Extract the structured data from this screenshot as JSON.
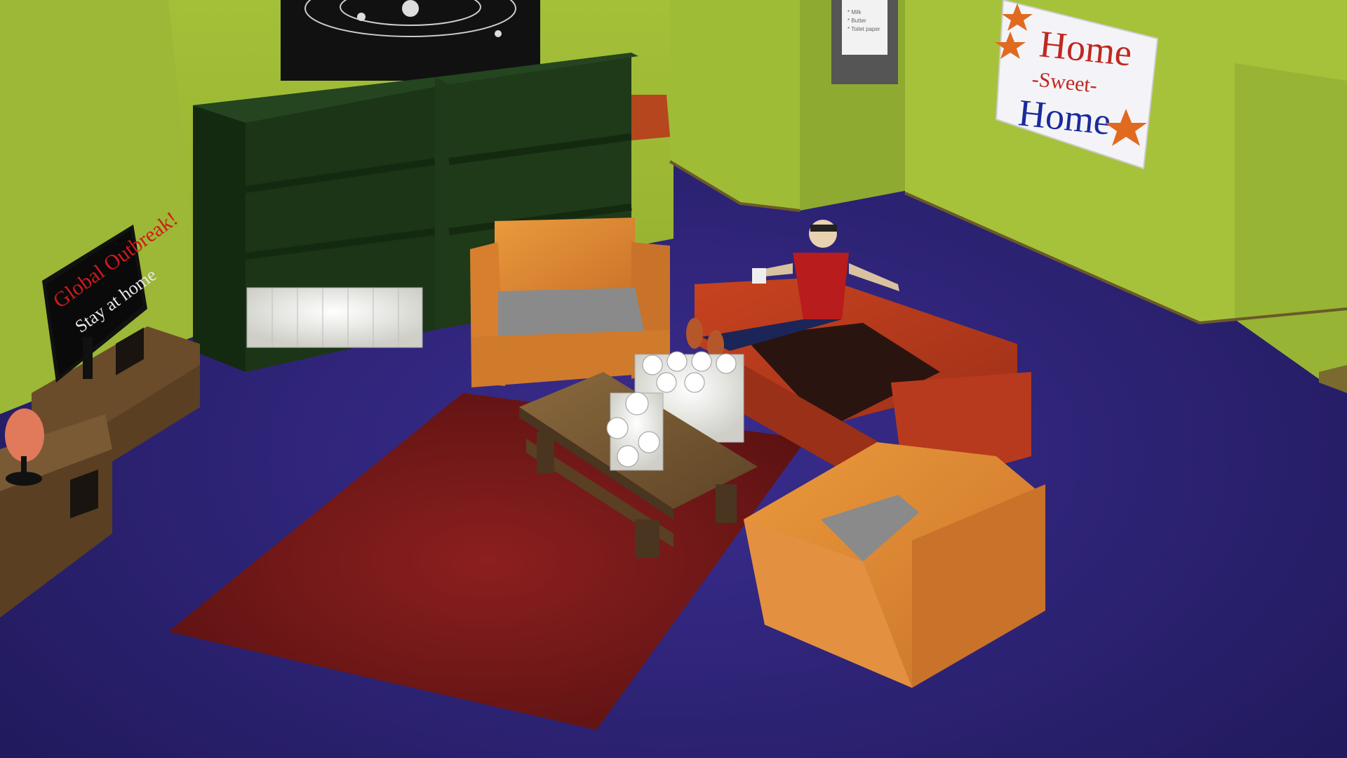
{
  "scene": {
    "tv": {
      "line1": "Global Outbreak!",
      "line2": "Stay at home"
    },
    "sign": {
      "line1": "Home",
      "line2": "-Sweet-",
      "line3": "Home"
    },
    "note": {
      "lines": [
        "* Milk",
        "* Butter",
        "* Toilet paper"
      ]
    }
  },
  "colors": {
    "wall": "#a9c43c",
    "floor": "#2e2479",
    "rug": "#7a1818",
    "bookshelf": "#1f3a17",
    "armchair": "#e08a30",
    "armchair_seat": "#8a8a8a",
    "sofa": "#b83a1e",
    "table": "#7a5a34",
    "sign_red": "#c0281f",
    "sign_blue": "#1a2a9c",
    "star": "#e06a20"
  }
}
